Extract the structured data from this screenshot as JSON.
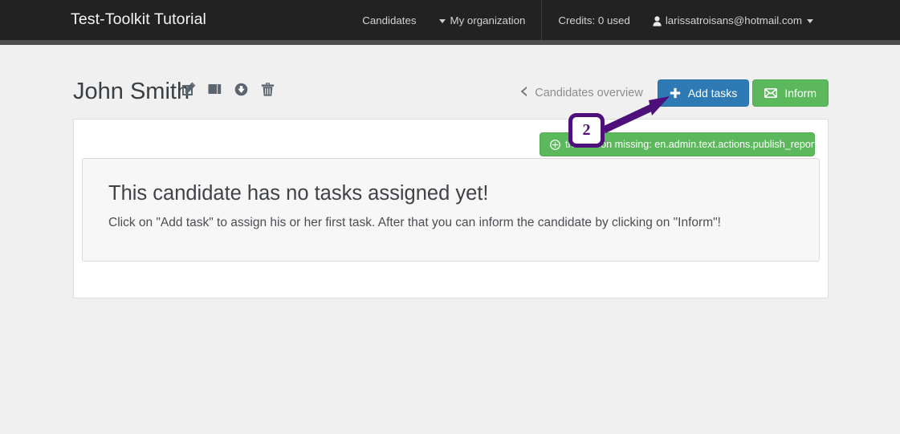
{
  "navbar": {
    "brand": "Test-Toolkit Tutorial",
    "items": [
      {
        "label": "Candidates",
        "icon": "none"
      },
      {
        "label": "My organization",
        "icon": "caret-down-icon"
      }
    ],
    "credits": "Credits: 0 used",
    "user": {
      "email": "larissatroisans@hotmail.com",
      "icon": "user-icon",
      "caret": "caret-down-icon"
    }
  },
  "page": {
    "title": "John Smith",
    "title_actions": [
      {
        "name": "edit-icon",
        "label": "Edit"
      },
      {
        "name": "copy-icon",
        "label": "Duplicate"
      },
      {
        "name": "download-icon",
        "label": "Download"
      },
      {
        "name": "trash-icon",
        "label": "Delete"
      }
    ],
    "back_link": "Candidates overview",
    "buttons": [
      {
        "name": "add-tasks-button",
        "label": "Add tasks",
        "icon": "plus-icon",
        "color": "#2e7ab4"
      },
      {
        "name": "inform-button",
        "label": "Inform",
        "icon": "envelope-icon",
        "color": "#5cb85c"
      }
    ]
  },
  "alert": {
    "text": "translation missing: en.admin.text.actions.publish_reports",
    "icon": "plus-circle-icon",
    "color": "#5cb85c"
  },
  "content": {
    "heading": "This candidate has no tasks assigned yet!",
    "subtext": "Click on \"Add task\" to assign his or her first task. After that you can inform the candidate by clicking on \"Inform\"!"
  },
  "annotation": {
    "step_number": "2",
    "color": "#4d0f7a"
  }
}
